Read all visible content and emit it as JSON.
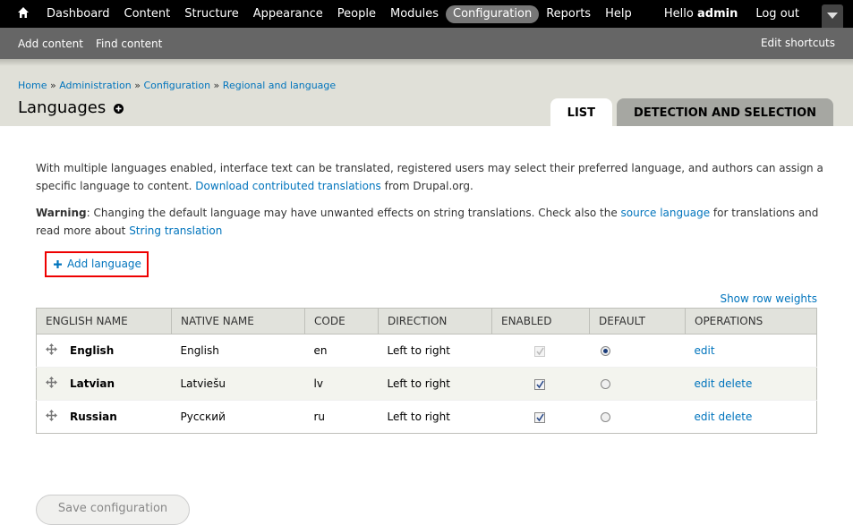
{
  "toolbar": {
    "menu": [
      "Dashboard",
      "Content",
      "Structure",
      "Appearance",
      "People",
      "Modules",
      "Configuration",
      "Reports",
      "Help"
    ],
    "active": "Configuration",
    "hello": "Hello",
    "username": "admin",
    "logout": "Log out"
  },
  "shortcuts": {
    "items": [
      "Add content",
      "Find content"
    ],
    "edit": "Edit shortcuts"
  },
  "breadcrumb": [
    "Home",
    "Administration",
    "Configuration",
    "Regional and language"
  ],
  "page_title": "Languages",
  "tabs": [
    "List",
    "Detection and selection"
  ],
  "intro": {
    "text": "With multiple languages enabled, interface text can be translated, registered users may select their preferred language, and authors can assign a specific language to content.",
    "link": "Download contributed translations",
    "suffix": "from Drupal.org."
  },
  "warning": {
    "label": "Warning",
    "text1": ": Changing the default language may have unwanted effects on string translations. Check also the",
    "link1": "source language",
    "text2": "for translations and read more about",
    "link2": "String translation"
  },
  "add_language": "Add language",
  "show_row_weights": "Show row weights",
  "table": {
    "headers": [
      "English name",
      "Native name",
      "Code",
      "Direction",
      "Enabled",
      "Default",
      "Operations"
    ],
    "rows": [
      {
        "english": "English",
        "native": "English",
        "code": "en",
        "direction": "Left to right",
        "enabled": true,
        "enabled_locked": true,
        "default": true,
        "ops": [
          "edit"
        ]
      },
      {
        "english": "Latvian",
        "native": "Latviešu",
        "code": "lv",
        "direction": "Left to right",
        "enabled": true,
        "enabled_locked": false,
        "default": false,
        "ops": [
          "edit",
          "delete"
        ]
      },
      {
        "english": "Russian",
        "native": "Русский",
        "code": "ru",
        "direction": "Left to right",
        "enabled": true,
        "enabled_locked": false,
        "default": false,
        "ops": [
          "edit",
          "delete"
        ]
      }
    ]
  },
  "save_button": "Save configuration",
  "colors": {
    "link": "#0074bd",
    "toolbar": "#000000",
    "shortcuts": "#666666",
    "highlight": "#ee0000"
  }
}
